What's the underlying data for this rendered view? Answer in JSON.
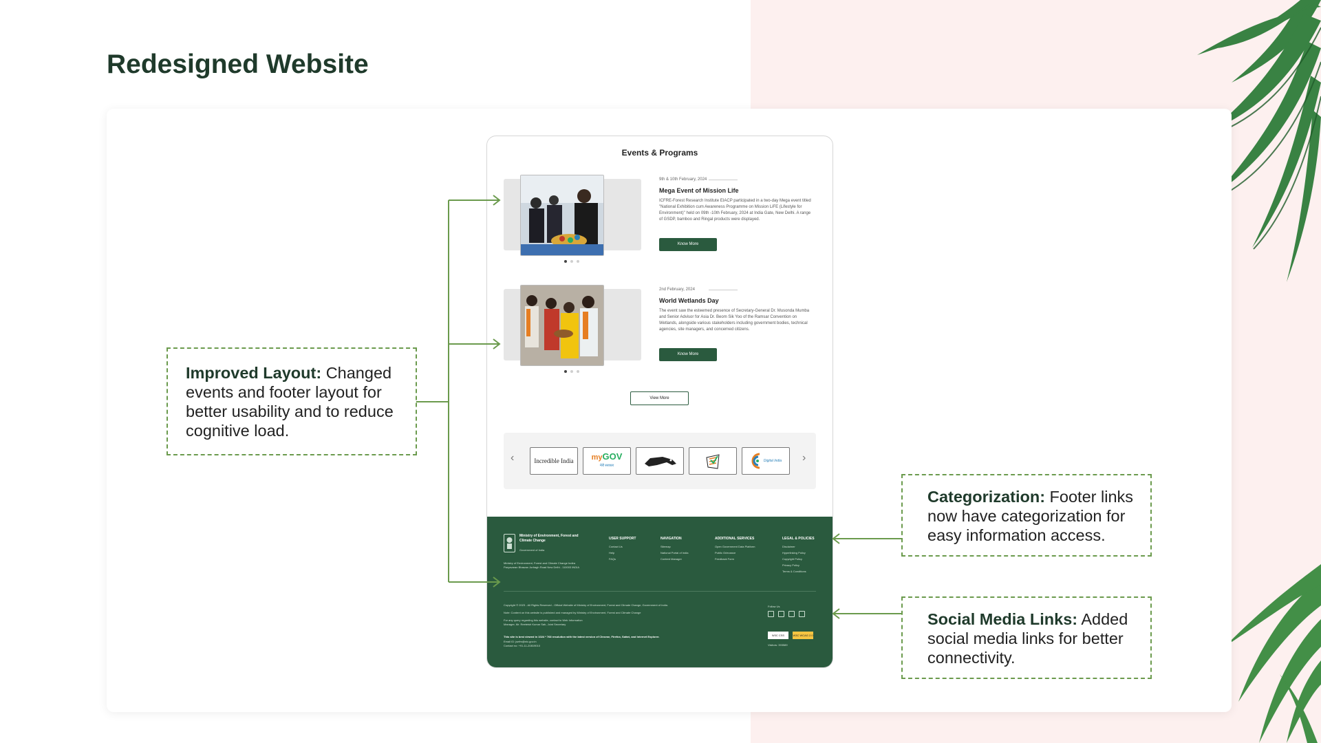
{
  "slide": {
    "title": "Redesigned Website"
  },
  "mock": {
    "events_heading": "Events & Programs",
    "events": [
      {
        "date": "9th & 10th February, 2024",
        "title": "Mega Event of Mission Life",
        "description": "ICFRE-Forest Research Institute EIACP participated in a two-day Mega event titled \"National Exhibition cum Awareness Programme on Mission LiFE (Lifestyle for Environment)\" held on 09th -10th February, 2024 at India Gate, New Delhi. A range of GSDP, bamboo and Ringal products were displayed.",
        "button": "Know More"
      },
      {
        "date": "2nd February, 2024",
        "title": "World Wetlands Day",
        "description": "The event saw the esteemed presence of Secretary-General Dr. Musonda Mumba and Senior Advisor for Asia Dr. Beom Sik Yoo of the Ramsar Convention on Wetlands, alongside various stakeholders including government bodies, technical agencies, site managers, and concerned citizens.",
        "button": "Know More"
      }
    ],
    "view_more": "View More",
    "logos": [
      "Incredible India",
      "my GOV",
      "Make in India",
      "ECI",
      "Digital India"
    ],
    "logo_texts": {
      "incredible": "Incredible India",
      "mygov_my": "my",
      "mygov_gov": "GOV",
      "mygov_hindi": "मेरी सरकार",
      "digital": "Digital India"
    },
    "footer": {
      "ministry": "Ministry of Environment, Forest and Climate Change",
      "government": "Government of India",
      "address": "Ministry of Environment, Forest and Climate Change Indira Paryavaran Bhawan Jorbagh Road New Delhi - 110003 INDIA",
      "columns": [
        {
          "heading": "USER SUPPORT",
          "links": [
            "Contact Us",
            "Help",
            "FAQs"
          ]
        },
        {
          "heading": "NAVIGATION",
          "links": [
            "Sitemap",
            "National Portal of India",
            "Content Manager"
          ]
        },
        {
          "heading": "ADDITIONAL SERVICES",
          "links": [
            "Open Government Data Platform",
            "Public Grievance",
            "Feedback Form"
          ]
        },
        {
          "heading": "LEGAL & POLICIES",
          "links": [
            "Disclaimer",
            "Hyperlinking Policy",
            "Copyright Policy",
            "Privacy Policy",
            "Terms & Conditions"
          ]
        }
      ],
      "copyright": "Copyright © 2023 - All Rights Reserved - Official Website of Ministry of Environment, Forest and Climate Change, Government of India.",
      "note": "Note: Content on this website is published and managed by Ministry of Environment, Forest and Climate Change",
      "queries": "For any query regarding this website, contact to Web Information Manager, Mr. Reeteish Kumar Sah, Joint Secretary",
      "browser": "This site is best viewed in 1024 * 768 resolution with the latest version of Chrome, Firefox, Safari, and Internet Explorer.",
      "email": "Email ID: jsefm@nic.gov.in",
      "contact": "Contact no: +91-11-20819010",
      "follow_us": "Follow Us",
      "badge_w3c": "W3C CSS",
      "badge_wcag": "W3C WCAG 2.0",
      "visitors": "Visitors: 393589"
    }
  },
  "annotations": {
    "layout": {
      "label": "Improved Layout:",
      "text": " Changed events and footer layout for better usability and to reduce cognitive load."
    },
    "categorization": {
      "label": "Categorization:",
      "text": " Footer links now have categorization for easy information access."
    },
    "social": {
      "label": "Social Media Links:",
      "text": " Added social media links for better connectivity."
    }
  },
  "colors": {
    "brand_green": "#2a5a3e",
    "accent_green": "#6a9a4c",
    "title_green": "#1f3a2b",
    "pink": "#fdf0ef"
  },
  "icons": [
    "palm-leaf-icon",
    "chevron-left-icon",
    "chevron-right-icon",
    "emblem-icon",
    "facebook-icon",
    "twitter-icon",
    "instagram-icon",
    "youtube-icon"
  ]
}
